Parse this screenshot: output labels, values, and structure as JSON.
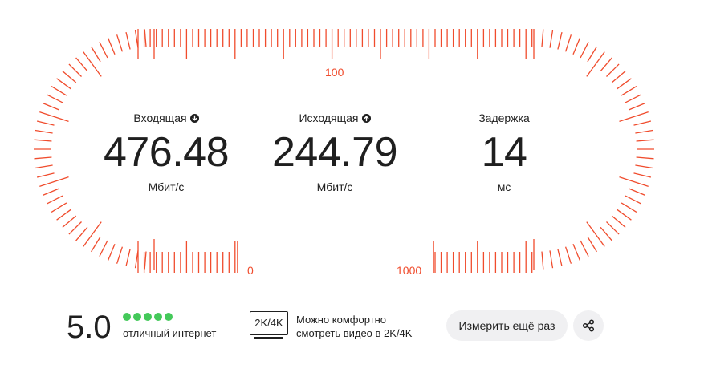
{
  "scale": {
    "label_0": "0",
    "label_100": "100",
    "label_1000": "1000"
  },
  "metrics": {
    "download": {
      "label": "Входящая",
      "value": "476.48",
      "unit": "Мбит/с",
      "icon": "arrow-down-circle-icon"
    },
    "upload": {
      "label": "Исходящая",
      "value": "244.79",
      "unit": "Мбит/с",
      "icon": "arrow-up-circle-icon"
    },
    "latency": {
      "label": "Задержка",
      "value": "14",
      "unit": "мс"
    }
  },
  "rating": {
    "score": "5.0",
    "filled": 5,
    "total": 5,
    "text": "отличный интернет"
  },
  "video": {
    "badge": "2K/4K",
    "line1": "Можно комфортно",
    "line2": "смотреть видео в 2K/4K"
  },
  "actions": {
    "retry_label": "Измерить ещё раз",
    "share_icon": "share-icon"
  },
  "colors": {
    "accent": "#f04c2d",
    "rating_dot": "#44c95a",
    "button_bg": "#f0f0f2"
  }
}
